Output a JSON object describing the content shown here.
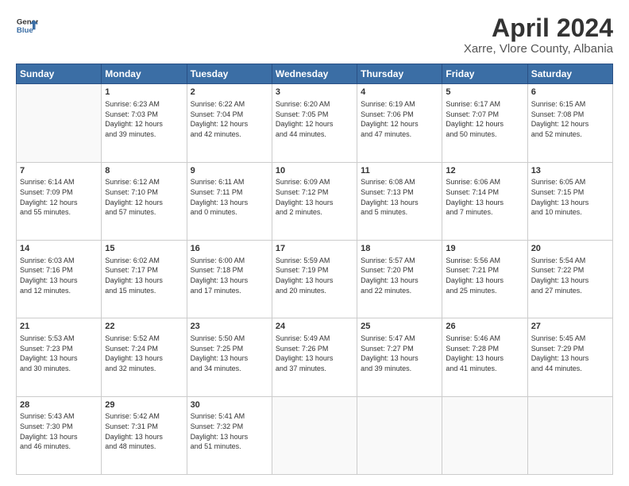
{
  "logo": {
    "line1": "General",
    "line2": "Blue"
  },
  "title": "April 2024",
  "subtitle": "Xarre, Vlore County, Albania",
  "header_days": [
    "Sunday",
    "Monday",
    "Tuesday",
    "Wednesday",
    "Thursday",
    "Friday",
    "Saturday"
  ],
  "weeks": [
    [
      {
        "day": "",
        "info": ""
      },
      {
        "day": "1",
        "info": "Sunrise: 6:23 AM\nSunset: 7:03 PM\nDaylight: 12 hours\nand 39 minutes."
      },
      {
        "day": "2",
        "info": "Sunrise: 6:22 AM\nSunset: 7:04 PM\nDaylight: 12 hours\nand 42 minutes."
      },
      {
        "day": "3",
        "info": "Sunrise: 6:20 AM\nSunset: 7:05 PM\nDaylight: 12 hours\nand 44 minutes."
      },
      {
        "day": "4",
        "info": "Sunrise: 6:19 AM\nSunset: 7:06 PM\nDaylight: 12 hours\nand 47 minutes."
      },
      {
        "day": "5",
        "info": "Sunrise: 6:17 AM\nSunset: 7:07 PM\nDaylight: 12 hours\nand 50 minutes."
      },
      {
        "day": "6",
        "info": "Sunrise: 6:15 AM\nSunset: 7:08 PM\nDaylight: 12 hours\nand 52 minutes."
      }
    ],
    [
      {
        "day": "7",
        "info": "Sunrise: 6:14 AM\nSunset: 7:09 PM\nDaylight: 12 hours\nand 55 minutes."
      },
      {
        "day": "8",
        "info": "Sunrise: 6:12 AM\nSunset: 7:10 PM\nDaylight: 12 hours\nand 57 minutes."
      },
      {
        "day": "9",
        "info": "Sunrise: 6:11 AM\nSunset: 7:11 PM\nDaylight: 13 hours\nand 0 minutes."
      },
      {
        "day": "10",
        "info": "Sunrise: 6:09 AM\nSunset: 7:12 PM\nDaylight: 13 hours\nand 2 minutes."
      },
      {
        "day": "11",
        "info": "Sunrise: 6:08 AM\nSunset: 7:13 PM\nDaylight: 13 hours\nand 5 minutes."
      },
      {
        "day": "12",
        "info": "Sunrise: 6:06 AM\nSunset: 7:14 PM\nDaylight: 13 hours\nand 7 minutes."
      },
      {
        "day": "13",
        "info": "Sunrise: 6:05 AM\nSunset: 7:15 PM\nDaylight: 13 hours\nand 10 minutes."
      }
    ],
    [
      {
        "day": "14",
        "info": "Sunrise: 6:03 AM\nSunset: 7:16 PM\nDaylight: 13 hours\nand 12 minutes."
      },
      {
        "day": "15",
        "info": "Sunrise: 6:02 AM\nSunset: 7:17 PM\nDaylight: 13 hours\nand 15 minutes."
      },
      {
        "day": "16",
        "info": "Sunrise: 6:00 AM\nSunset: 7:18 PM\nDaylight: 13 hours\nand 17 minutes."
      },
      {
        "day": "17",
        "info": "Sunrise: 5:59 AM\nSunset: 7:19 PM\nDaylight: 13 hours\nand 20 minutes."
      },
      {
        "day": "18",
        "info": "Sunrise: 5:57 AM\nSunset: 7:20 PM\nDaylight: 13 hours\nand 22 minutes."
      },
      {
        "day": "19",
        "info": "Sunrise: 5:56 AM\nSunset: 7:21 PM\nDaylight: 13 hours\nand 25 minutes."
      },
      {
        "day": "20",
        "info": "Sunrise: 5:54 AM\nSunset: 7:22 PM\nDaylight: 13 hours\nand 27 minutes."
      }
    ],
    [
      {
        "day": "21",
        "info": "Sunrise: 5:53 AM\nSunset: 7:23 PM\nDaylight: 13 hours\nand 30 minutes."
      },
      {
        "day": "22",
        "info": "Sunrise: 5:52 AM\nSunset: 7:24 PM\nDaylight: 13 hours\nand 32 minutes."
      },
      {
        "day": "23",
        "info": "Sunrise: 5:50 AM\nSunset: 7:25 PM\nDaylight: 13 hours\nand 34 minutes."
      },
      {
        "day": "24",
        "info": "Sunrise: 5:49 AM\nSunset: 7:26 PM\nDaylight: 13 hours\nand 37 minutes."
      },
      {
        "day": "25",
        "info": "Sunrise: 5:47 AM\nSunset: 7:27 PM\nDaylight: 13 hours\nand 39 minutes."
      },
      {
        "day": "26",
        "info": "Sunrise: 5:46 AM\nSunset: 7:28 PM\nDaylight: 13 hours\nand 41 minutes."
      },
      {
        "day": "27",
        "info": "Sunrise: 5:45 AM\nSunset: 7:29 PM\nDaylight: 13 hours\nand 44 minutes."
      }
    ],
    [
      {
        "day": "28",
        "info": "Sunrise: 5:43 AM\nSunset: 7:30 PM\nDaylight: 13 hours\nand 46 minutes."
      },
      {
        "day": "29",
        "info": "Sunrise: 5:42 AM\nSunset: 7:31 PM\nDaylight: 13 hours\nand 48 minutes."
      },
      {
        "day": "30",
        "info": "Sunrise: 5:41 AM\nSunset: 7:32 PM\nDaylight: 13 hours\nand 51 minutes."
      },
      {
        "day": "",
        "info": ""
      },
      {
        "day": "",
        "info": ""
      },
      {
        "day": "",
        "info": ""
      },
      {
        "day": "",
        "info": ""
      }
    ]
  ]
}
